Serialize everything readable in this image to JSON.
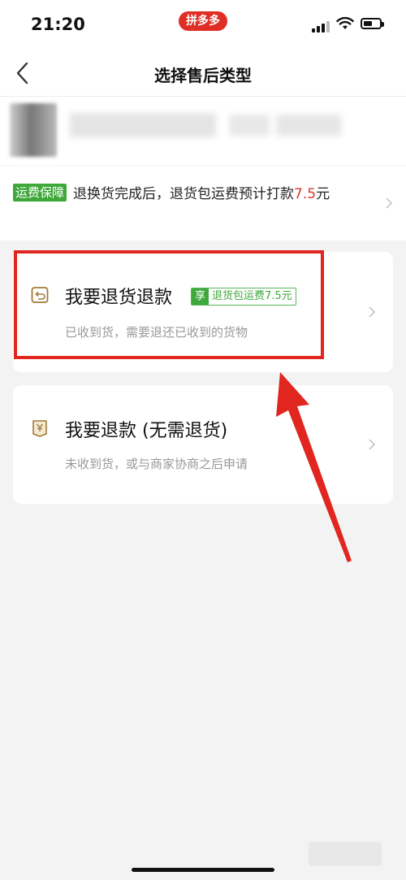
{
  "status_bar": {
    "time": "21:20",
    "app_badge": "拼多多",
    "badge_color": "#e02e24"
  },
  "header": {
    "back_icon": "chevron-left-icon",
    "title": "选择售后类型"
  },
  "notice": {
    "tag": "运费保障",
    "text_before": "退换货完成后，退货包运费预计打款",
    "amount": "7.5",
    "text_after": "元",
    "tag_color": "#3ea83a"
  },
  "options": [
    {
      "title": "我要退货退款",
      "badge_prefix": "享",
      "badge_text": "退货包运费7.5元",
      "subtitle": "已收到货，需要退还已收到的货物",
      "icon": "return-box-icon"
    },
    {
      "title": "我要退款 (无需退货)",
      "subtitle": "未收到货，或与商家协商之后申请",
      "icon": "yen-envelope-icon"
    }
  ],
  "annotation": {
    "highlight_color": "#e0261f"
  }
}
